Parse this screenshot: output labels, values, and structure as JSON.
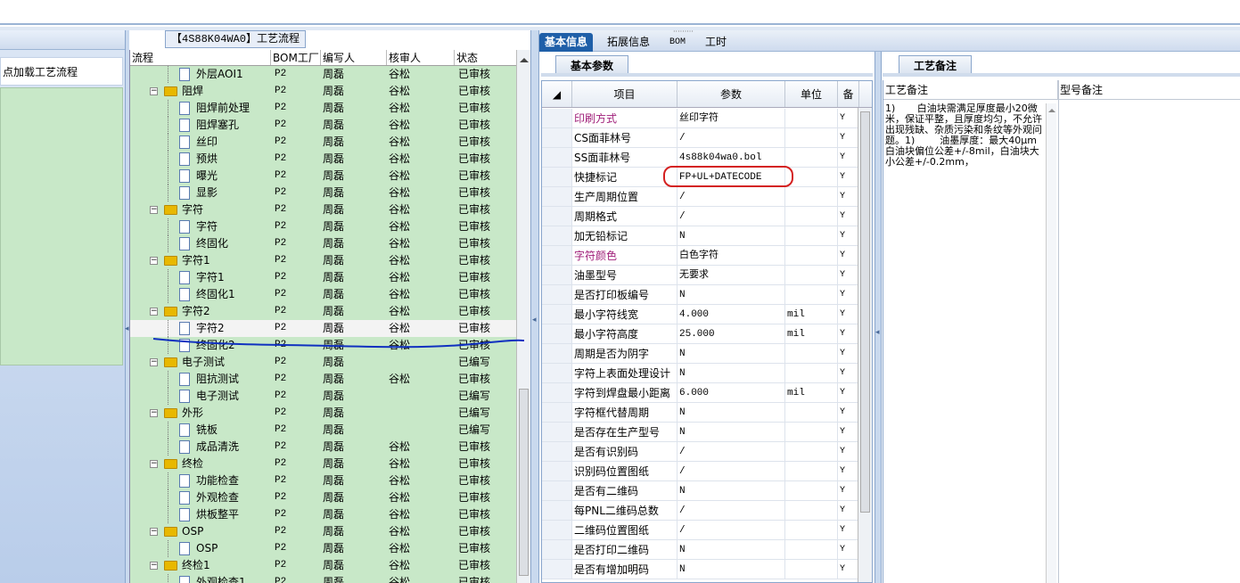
{
  "left_panel": {
    "load_button_label": "点加载工艺流程"
  },
  "tree": {
    "title": "【4S88K04WA0】工艺流程",
    "headers": [
      "流程",
      "BOM工厂",
      "编写人",
      "核审人",
      "状态"
    ],
    "rows": [
      {
        "type": "file",
        "label": "外层AOI1",
        "bom": "P2",
        "writer": "周磊",
        "reviewer": "谷松",
        "status": "已审核"
      },
      {
        "type": "folder",
        "label": "阻焊",
        "bom": "P2",
        "writer": "周磊",
        "reviewer": "谷松",
        "status": "已审核"
      },
      {
        "type": "file",
        "label": "阻焊前处理",
        "bom": "P2",
        "writer": "周磊",
        "reviewer": "谷松",
        "status": "已审核"
      },
      {
        "type": "file",
        "label": "阻焊塞孔",
        "bom": "P2",
        "writer": "周磊",
        "reviewer": "谷松",
        "status": "已审核"
      },
      {
        "type": "file",
        "label": "丝印",
        "bom": "P2",
        "writer": "周磊",
        "reviewer": "谷松",
        "status": "已审核"
      },
      {
        "type": "file",
        "label": "预烘",
        "bom": "P2",
        "writer": "周磊",
        "reviewer": "谷松",
        "status": "已审核"
      },
      {
        "type": "file",
        "label": "曝光",
        "bom": "P2",
        "writer": "周磊",
        "reviewer": "谷松",
        "status": "已审核"
      },
      {
        "type": "file",
        "label": "显影",
        "bom": "P2",
        "writer": "周磊",
        "reviewer": "谷松",
        "status": "已审核"
      },
      {
        "type": "folder",
        "label": "字符",
        "bom": "P2",
        "writer": "周磊",
        "reviewer": "谷松",
        "status": "已审核"
      },
      {
        "type": "file",
        "label": "字符",
        "bom": "P2",
        "writer": "周磊",
        "reviewer": "谷松",
        "status": "已审核"
      },
      {
        "type": "file",
        "label": "终固化",
        "bom": "P2",
        "writer": "周磊",
        "reviewer": "谷松",
        "status": "已审核"
      },
      {
        "type": "folder",
        "label": "字符1",
        "bom": "P2",
        "writer": "周磊",
        "reviewer": "谷松",
        "status": "已审核"
      },
      {
        "type": "file",
        "label": "字符1",
        "bom": "P2",
        "writer": "周磊",
        "reviewer": "谷松",
        "status": "已审核"
      },
      {
        "type": "file",
        "label": "终固化1",
        "bom": "P2",
        "writer": "周磊",
        "reviewer": "谷松",
        "status": "已审核"
      },
      {
        "type": "folder",
        "label": "字符2",
        "bom": "P2",
        "writer": "周磊",
        "reviewer": "谷松",
        "status": "已审核"
      },
      {
        "type": "file",
        "label": "字符2",
        "bom": "P2",
        "writer": "周磊",
        "reviewer": "谷松",
        "status": "已审核",
        "selected": true
      },
      {
        "type": "file",
        "label": "终固化2",
        "bom": "P2",
        "writer": "周磊",
        "reviewer": "谷松",
        "status": "已审核"
      },
      {
        "type": "folder",
        "label": "电子测试",
        "bom": "P2",
        "writer": "周磊",
        "reviewer": "",
        "status": "已编写"
      },
      {
        "type": "file",
        "label": "阻抗测试",
        "bom": "P2",
        "writer": "周磊",
        "reviewer": "谷松",
        "status": "已审核"
      },
      {
        "type": "file",
        "label": "电子测试",
        "bom": "P2",
        "writer": "周磊",
        "reviewer": "",
        "status": "已编写"
      },
      {
        "type": "folder",
        "label": "外形",
        "bom": "P2",
        "writer": "周磊",
        "reviewer": "",
        "status": "已编写"
      },
      {
        "type": "file",
        "label": "铣板",
        "bom": "P2",
        "writer": "周磊",
        "reviewer": "",
        "status": "已编写"
      },
      {
        "type": "file",
        "label": "成品清洗",
        "bom": "P2",
        "writer": "周磊",
        "reviewer": "谷松",
        "status": "已审核"
      },
      {
        "type": "folder",
        "label": "终检",
        "bom": "P2",
        "writer": "周磊",
        "reviewer": "谷松",
        "status": "已审核"
      },
      {
        "type": "file",
        "label": "功能检查",
        "bom": "P2",
        "writer": "周磊",
        "reviewer": "谷松",
        "status": "已审核"
      },
      {
        "type": "file",
        "label": "外观检查",
        "bom": "P2",
        "writer": "周磊",
        "reviewer": "谷松",
        "status": "已审核"
      },
      {
        "type": "file",
        "label": "烘板整平",
        "bom": "P2",
        "writer": "周磊",
        "reviewer": "谷松",
        "status": "已审核"
      },
      {
        "type": "folder",
        "label": "OSP",
        "bom": "P2",
        "writer": "周磊",
        "reviewer": "谷松",
        "status": "已审核"
      },
      {
        "type": "file",
        "label": "OSP",
        "bom": "P2",
        "writer": "周磊",
        "reviewer": "谷松",
        "status": "已审核"
      },
      {
        "type": "folder",
        "label": "终检1",
        "bom": "P2",
        "writer": "周磊",
        "reviewer": "谷松",
        "status": "已审核"
      },
      {
        "type": "file",
        "label": "外观检查1",
        "bom": "P2",
        "writer": "周磊",
        "reviewer": "谷松",
        "status": "已审核"
      }
    ]
  },
  "tabs": [
    "基本信息",
    "拓展信息",
    "BOM",
    "工时"
  ],
  "basic_params": {
    "subtab": "基本参数",
    "headers": [
      "项目",
      "参数",
      "单位",
      "备"
    ],
    "rows": [
      {
        "item": "印刷方式",
        "value": "丝印字符",
        "unit": "",
        "flag": "Y",
        "color": "#a0207a"
      },
      {
        "item": "CS面菲林号",
        "value": "/",
        "unit": "",
        "flag": "Y",
        "color": ""
      },
      {
        "item": "SS面菲林号",
        "value": "4s88k04wa0.bol",
        "unit": "",
        "flag": "Y",
        "color": ""
      },
      {
        "item": "快捷标记",
        "value": "FP+UL+DATECODE",
        "unit": "",
        "flag": "Y",
        "color": ""
      },
      {
        "item": "生产周期位置",
        "value": "/",
        "unit": "",
        "flag": "Y",
        "color": ""
      },
      {
        "item": "周期格式",
        "value": "/",
        "unit": "",
        "flag": "Y",
        "color": ""
      },
      {
        "item": "加无铅标记",
        "value": "N",
        "unit": "",
        "flag": "Y",
        "color": ""
      },
      {
        "item": "字符颜色",
        "value": "白色字符",
        "unit": "",
        "flag": "Y",
        "color": "#a0207a"
      },
      {
        "item": "油墨型号",
        "value": "无要求",
        "unit": "",
        "flag": "Y",
        "color": ""
      },
      {
        "item": "是否打印板编号",
        "value": "N",
        "unit": "",
        "flag": "Y",
        "color": ""
      },
      {
        "item": "最小字符线宽",
        "value": "4.000",
        "unit": "mil",
        "flag": "Y",
        "color": ""
      },
      {
        "item": "最小字符高度",
        "value": "25.000",
        "unit": "mil",
        "flag": "Y",
        "color": ""
      },
      {
        "item": "周期是否为阴字",
        "value": "N",
        "unit": "",
        "flag": "Y",
        "color": ""
      },
      {
        "item": "字符上表面处理设计",
        "value": "N",
        "unit": "",
        "flag": "Y",
        "color": ""
      },
      {
        "item": "字符到焊盘最小距离",
        "value": "6.000",
        "unit": "mil",
        "flag": "Y",
        "color": ""
      },
      {
        "item": "字符框代替周期",
        "value": "N",
        "unit": "",
        "flag": "Y",
        "color": ""
      },
      {
        "item": "是否存在生产型号",
        "value": "N",
        "unit": "",
        "flag": "Y",
        "color": ""
      },
      {
        "item": "是否有识别码",
        "value": "/",
        "unit": "",
        "flag": "Y",
        "color": ""
      },
      {
        "item": "识别码位置图纸",
        "value": "/",
        "unit": "",
        "flag": "Y",
        "color": ""
      },
      {
        "item": "是否有二维码",
        "value": "N",
        "unit": "",
        "flag": "Y",
        "color": ""
      },
      {
        "item": "每PNL二维码总数",
        "value": "/",
        "unit": "",
        "flag": "Y",
        "color": ""
      },
      {
        "item": "二维码位置图纸",
        "value": "/",
        "unit": "",
        "flag": "Y",
        "color": ""
      },
      {
        "item": "是否打印二维码",
        "value": "N",
        "unit": "",
        "flag": "Y",
        "color": ""
      },
      {
        "item": "是否有增加明码",
        "value": "N",
        "unit": "",
        "flag": "Y",
        "color": ""
      }
    ]
  },
  "notes": {
    "subtab": "工艺备注",
    "col1": "工艺备注",
    "col2": "型号备注",
    "text": "1)       白油块需满足厚度最小20微米，保证平整，且厚度均匀，不允许出现残缺、杂质污染和条纹等外观问题。1)        油墨厚度：最大40μm白油块偏位公差+/-8mil，白油块大小公差+/-0.2mm，"
  },
  "colors": {
    "accent": "#1f5fa8",
    "tree_bg": "#c8e8c8",
    "annotation_red": "#d42020",
    "annotation_blue": "#1030c0"
  }
}
